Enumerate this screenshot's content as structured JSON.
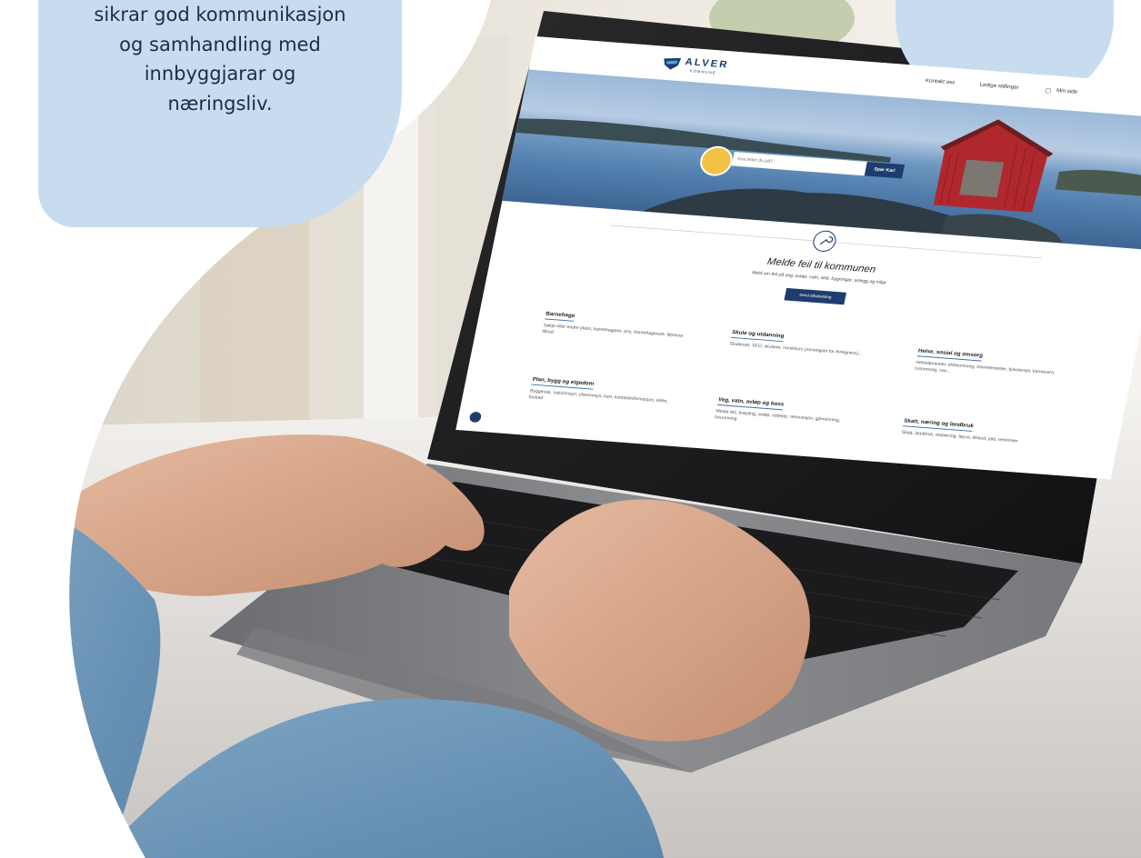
{
  "bubble": {
    "lines": [
      "sikrar god kommunikasjon",
      "og samhandling med",
      "innbyggjarar og",
      "næringsliv."
    ]
  },
  "site": {
    "logo_name": "ALVER",
    "logo_sub": "KOMMUNE",
    "nav": [
      "Kontakt oss",
      "Ledige stillingar",
      "Min side"
    ],
    "search": {
      "placeholder": "Kva leiter du på?",
      "button": "Spør Kari"
    },
    "report": {
      "title": "Melde feil til kommunen",
      "subtitle": "Meld om feil på veg, avløp, vatn, skilt, bygningar, anlegg og miljø",
      "button": "Send tilbakelding"
    },
    "categories": [
      {
        "title": "Barnehage",
        "desc": "Søkje eller endre plass, barnehagane, pris, barnehagerute, tilpassa tilbod"
      },
      {
        "title": "Skule og utdanning",
        "desc": "Skulerute, SFO, skulane, norskkurs (norwegian for foreigners)..."
      },
      {
        "title": "Helse, sosial og omsorg",
        "desc": "Helsetjenester, eldreomsorg, heimetenester, fysioterapi, barnevern, rusomsorg, nav..."
      },
      {
        "title": "Plan, bygg og eigedom",
        "desc": "Byggesak, saksinnsyn, planinnsyn, kart, kontaktinformasjon, eldre, bustad"
      },
      {
        "title": "Veg, vatn, avløp og boss",
        "desc": "Melde feil, brøyting, avløp, utslepp, renovasjon, gjenvinning, forureining"
      },
      {
        "title": "Skatt, næring og landbruk",
        "desc": "Skatt, landbruk, etablering, løyve, tilskott, jakt, veterinær"
      }
    ]
  },
  "colors": {
    "bubble": "#c7ddef",
    "brand": "#1c3d6e",
    "text_dark": "#1f2b40",
    "barn_red": "#b0282e"
  }
}
